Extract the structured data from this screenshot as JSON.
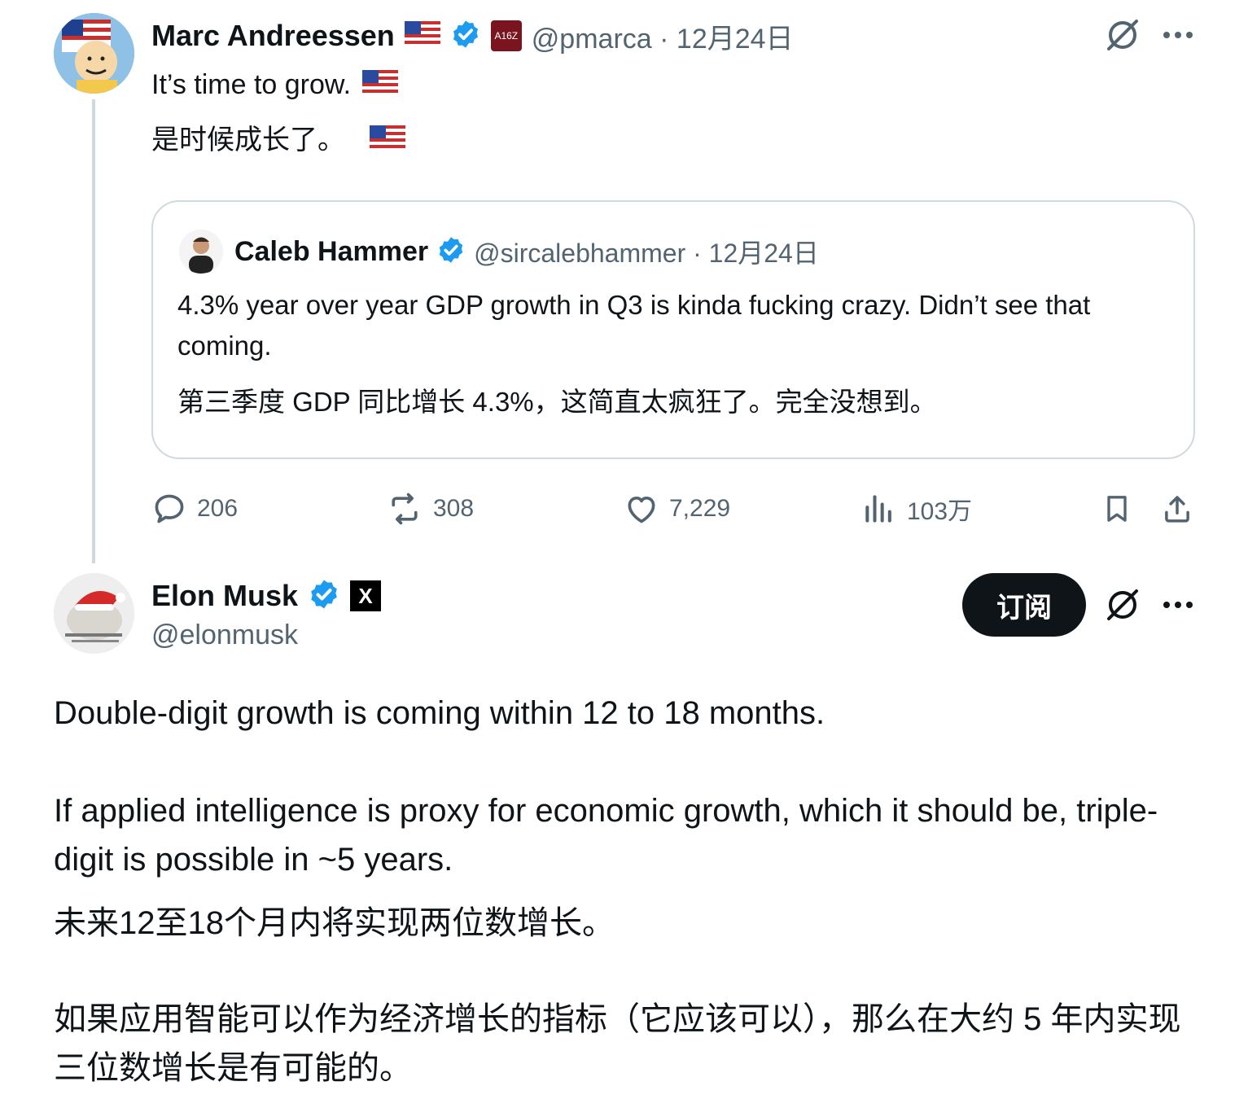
{
  "post1": {
    "name": "Marc Andreessen",
    "org_badge": "A16Z",
    "handle": "@pmarca",
    "time": "12月24日",
    "text_en": "It’s time to grow.",
    "text_zh": "是时候成长了。"
  },
  "quote": {
    "name": "Caleb Hammer",
    "handle": "@sircalebhammer",
    "time": "12月24日",
    "text_en": "4.3% year over year GDP growth in Q3 is kinda fucking crazy. Didn’t see that coming.",
    "text_zh": "第三季度 GDP 同比增长 4.3%，这简直太疯狂了。完全没想到。"
  },
  "actions": {
    "replies": "206",
    "reposts": "308",
    "likes": "7,229",
    "views": "103万"
  },
  "post2": {
    "name": "Elon Musk",
    "org_badge": "X",
    "handle": "@elonmusk",
    "subscribe_label": "订阅",
    "para1_en": "Double-digit growth is coming within 12 to 18 months.",
    "para2_en": "If applied intelligence is proxy for economic growth, which it should be, triple-digit is possible in ~5 years.",
    "para1_zh": "未来12至18个月内将实现两位数增长。",
    "para2_zh": "如果应用智能可以作为经济增长的指标（它应该可以），那么在大约 5 年内实现三位数增长是有可能的。"
  },
  "colors": {
    "verified": "#1d9bf0",
    "muted": "#536471",
    "border": "#cfd9de",
    "button_bg": "#0f1419"
  },
  "icons": [
    "grok-icon",
    "more-icon",
    "reply-icon",
    "repost-icon",
    "like-icon",
    "views-icon",
    "bookmark-icon",
    "share-icon",
    "verified-icon",
    "us-flag-icon"
  ]
}
